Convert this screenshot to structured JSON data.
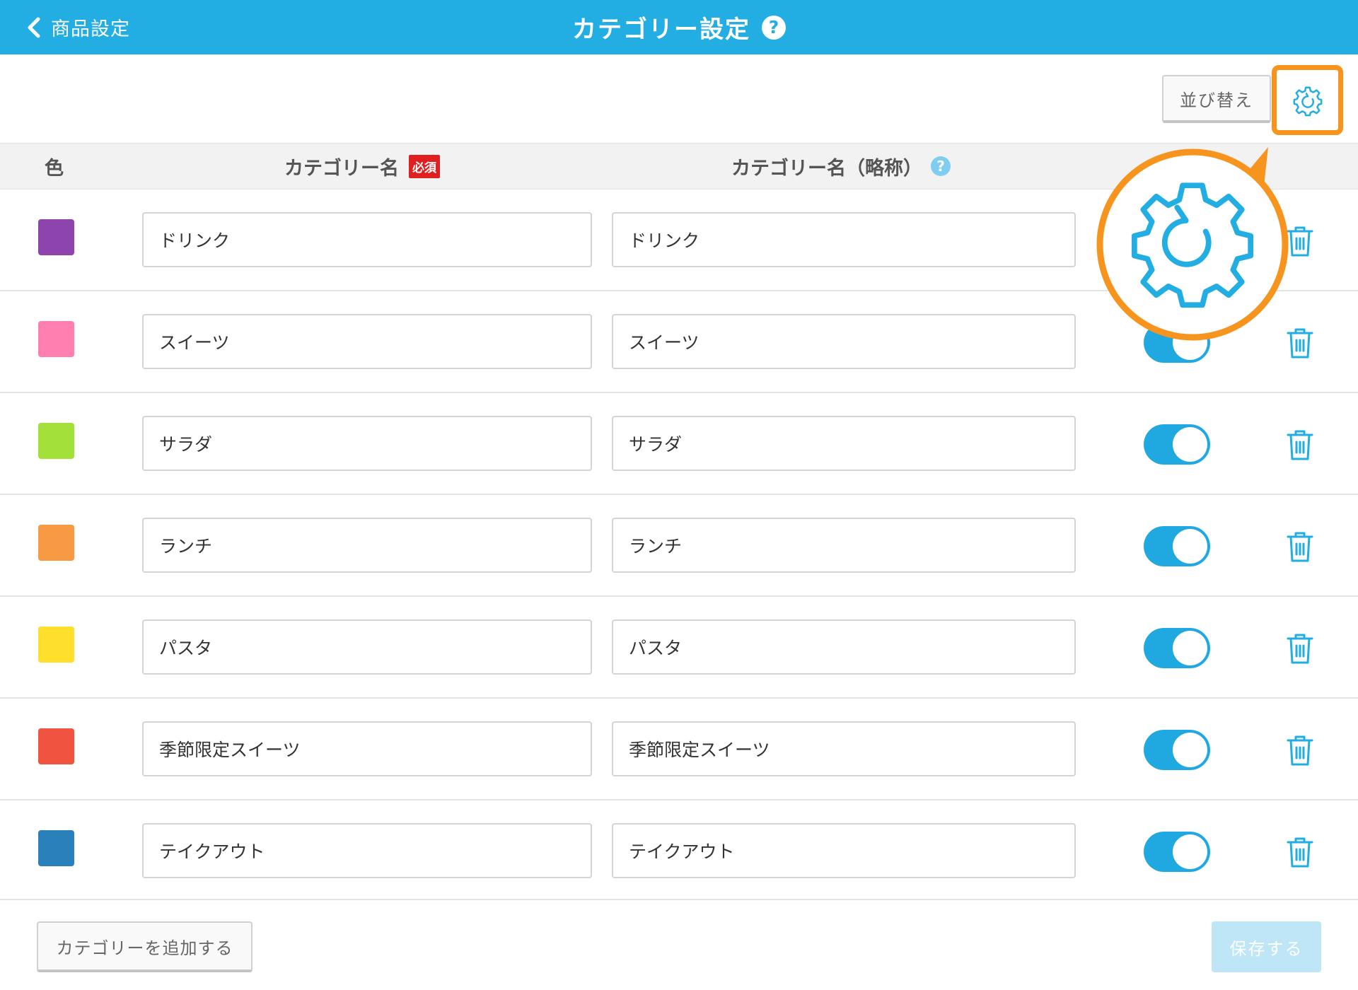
{
  "header": {
    "back_label": "商品設定",
    "title": "カテゴリー設定",
    "help": "?"
  },
  "toolbar": {
    "sort_label": "並び替え",
    "settings_icon": "gear-icon"
  },
  "table": {
    "headers": {
      "color": "色",
      "name": "カテゴリー名",
      "required_badge": "必須",
      "abbr": "カテゴリー名（略称）",
      "help": "?"
    },
    "rows": [
      {
        "color": "#8e44ad",
        "name": "ドリンク",
        "abbr": "ドリンク",
        "enabled": true
      },
      {
        "color": "#ff80b0",
        "name": "スイーツ",
        "abbr": "スイーツ",
        "enabled": true
      },
      {
        "color": "#a4e03a",
        "name": "サラダ",
        "abbr": "サラダ",
        "enabled": true
      },
      {
        "color": "#f89a44",
        "name": "ランチ",
        "abbr": "ランチ",
        "enabled": true
      },
      {
        "color": "#fddf2c",
        "name": "パスタ",
        "abbr": "パスタ",
        "enabled": true
      },
      {
        "color": "#f0533f",
        "name": "季節限定スイーツ",
        "abbr": "季節限定スイーツ",
        "enabled": true
      },
      {
        "color": "#2a80bb",
        "name": "テイクアウト",
        "abbr": "テイクアウト",
        "enabled": true
      }
    ]
  },
  "footer": {
    "add_label": "カテゴリーを追加する",
    "save_label": "保存する"
  },
  "colors": {
    "header": "#22ade3",
    "accent": "#20a8e0",
    "highlight": "#f7941d"
  }
}
